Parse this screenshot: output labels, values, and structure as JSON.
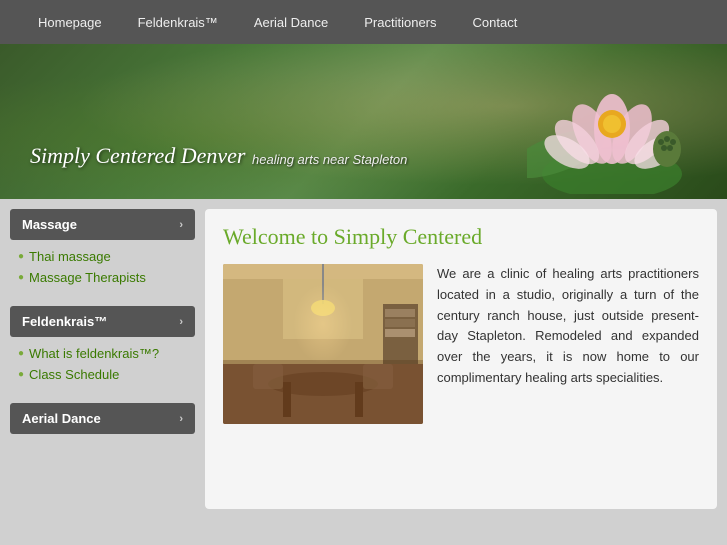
{
  "nav": {
    "items": [
      {
        "label": "Homepage",
        "id": "homepage"
      },
      {
        "label": "Feldenkrais™",
        "id": "feldenkrais"
      },
      {
        "label": "Aerial Dance",
        "id": "aerial-dance"
      },
      {
        "label": "Practitioners",
        "id": "practitioners"
      },
      {
        "label": "Contact",
        "id": "contact"
      }
    ]
  },
  "hero": {
    "title": "Simply Centered Denver",
    "subtitle": "healing arts near Stapleton"
  },
  "sidebar": {
    "sections": [
      {
        "id": "massage",
        "header": "Massage",
        "links": [
          {
            "label": "Thai massage",
            "id": "thai-massage"
          },
          {
            "label": "Massage Therapists",
            "id": "massage-therapists"
          }
        ]
      },
      {
        "id": "feldenkrais",
        "header": "Feldenkrais™",
        "links": [
          {
            "label": "What is feldenkrais™?",
            "id": "what-is-feldenkrais"
          },
          {
            "label": "Class Schedule",
            "id": "class-schedule"
          }
        ]
      },
      {
        "id": "aerial",
        "header": "Aerial Dance",
        "links": []
      }
    ]
  },
  "content": {
    "title": "Welcome to Simply Centered",
    "body": "We are a clinic of healing arts practitioners located in a studio, originally a turn of the century ranch house, just outside present-day Stapleton. Remodeled and expanded over the years, it is now home to our complimentary healing arts specialities."
  }
}
